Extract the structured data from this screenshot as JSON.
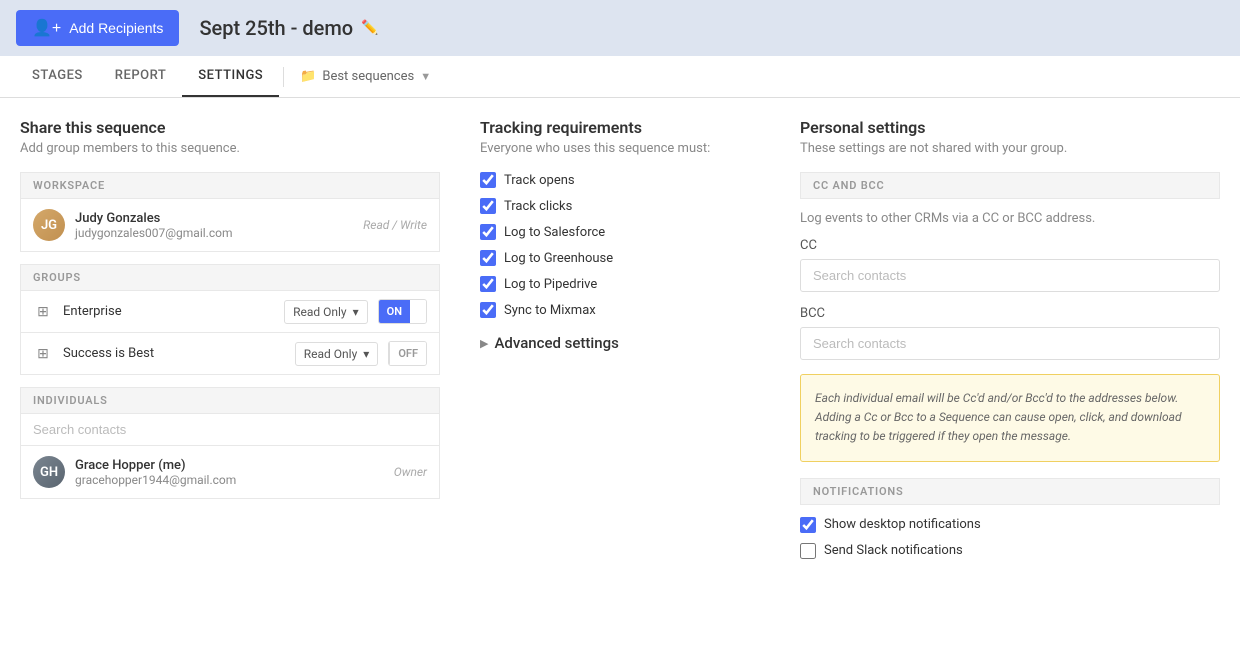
{
  "header": {
    "add_recipients_label": "Add Recipients",
    "sequence_title": "Sept 25th - demo"
  },
  "tabs": {
    "stages": "STAGES",
    "report": "REPORT",
    "settings": "SETTINGS",
    "best_sequences": "Best sequences"
  },
  "share": {
    "title": "Share this sequence",
    "subtitle": "Add group members to this sequence.",
    "workspace_label": "WORKSPACE",
    "groups_label": "GROUPS",
    "individuals_label": "INDIVIDUALS",
    "workspace_member": {
      "name": "Judy Gonzales",
      "email": "judygonzales007@gmail.com",
      "role": "Read / Write",
      "initials": "JG"
    },
    "groups": [
      {
        "name": "Enterprise",
        "permission": "Read Only",
        "toggle_state": "on"
      },
      {
        "name": "Success is Best",
        "permission": "Read Only",
        "toggle_state": "off"
      }
    ],
    "search_placeholder": "Search contacts",
    "individual_member": {
      "name": "Grace Hopper (me)",
      "email": "gracehopper1944@gmail.com",
      "role": "Owner",
      "initials": "GH"
    }
  },
  "tracking": {
    "title": "Tracking requirements",
    "subtitle": "Everyone who uses this sequence must:",
    "items": [
      {
        "label": "Track opens",
        "checked": true
      },
      {
        "label": "Track clicks",
        "checked": true
      },
      {
        "label": "Log to Salesforce",
        "checked": true
      },
      {
        "label": "Log to Greenhouse",
        "checked": true
      },
      {
        "label": "Log to Pipedrive",
        "checked": true
      },
      {
        "label": "Sync to Mixmax",
        "checked": true
      }
    ],
    "advanced_settings": "Advanced settings"
  },
  "personal": {
    "title": "Personal settings",
    "subtitle": "These settings are not shared with your group.",
    "cc_bcc_label": "CC AND BCC",
    "cc_bcc_description": "Log events to other CRMs via a CC or BCC address.",
    "cc_label": "CC",
    "cc_placeholder": "Search contacts",
    "bcc_label": "BCC",
    "bcc_placeholder": "Search contacts",
    "info_text": "Each individual email will be Cc'd and/or Bcc'd to the addresses below. Adding a Cc or Bcc to a Sequence can cause open, click, and download tracking to be triggered if they open the message.",
    "notifications_label": "NOTIFICATIONS",
    "notifications": [
      {
        "label": "Show desktop notifications",
        "checked": true
      },
      {
        "label": "Send Slack notifications",
        "checked": false
      }
    ]
  },
  "icons": {
    "add_person": "👤",
    "edit": "✏️",
    "folder": "📁",
    "dropdown": "▼",
    "chevron_right": "▶",
    "grid": "⊞",
    "chevron_select": "▾"
  }
}
